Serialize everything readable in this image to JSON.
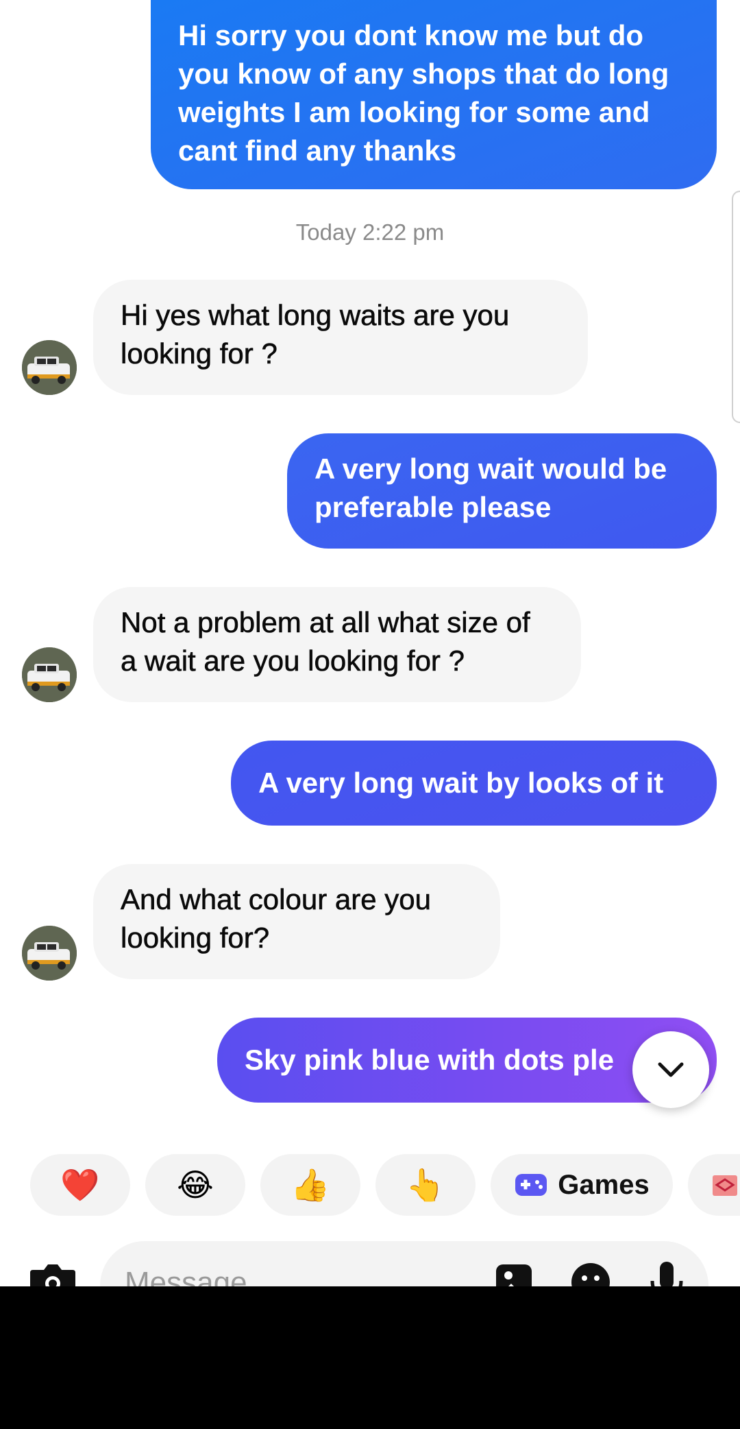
{
  "messages": {
    "m1": "Hi sorry you dont know me but do you know of any shops that do long weights I am looking for some and cant find any thanks",
    "m2": "Hi yes what long waits are you looking for ?",
    "m3": "A very long wait would be preferable please",
    "m4": "Not a problem at all what size of a wait are you looking for ?",
    "m5": "A very long wait by looks of it",
    "m6": "And what colour are you looking for?",
    "m7": "Sky pink blue with dots ple"
  },
  "timestamp": "Today 2:22 pm",
  "quick_replies": {
    "heart": "❤️",
    "laugh": "😂",
    "thumbs": "👍",
    "point": "👆",
    "games_icon": "game-controller-icon",
    "games_label": "Games",
    "gift_icon": "gift-icon"
  },
  "composer": {
    "placeholder": "Message",
    "camera_icon": "camera-icon",
    "gallery_icon": "gallery-icon",
    "sticker_icon": "sticker-icon",
    "mic_icon": "microphone-icon"
  },
  "colors": {
    "outgoing_start": "#1877f2",
    "outgoing_mid": "#3b5bf0",
    "outgoing_end": "#8b4cf2",
    "incoming": "#f5f5f5"
  }
}
